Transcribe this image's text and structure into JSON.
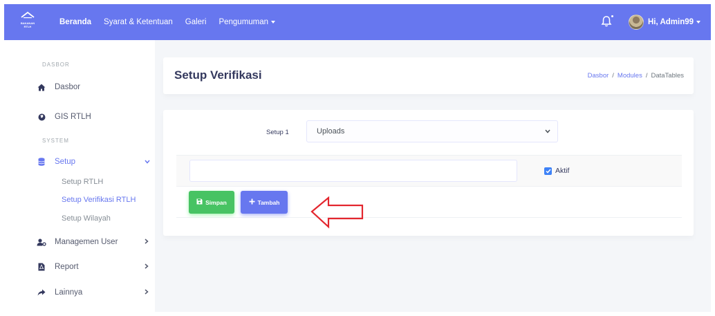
{
  "app": {
    "logo_text": [
      "BAKANAN",
      "RTLH"
    ]
  },
  "topnav": {
    "items": [
      {
        "label": "Beranda"
      },
      {
        "label": "Syarat & Ketentuan"
      },
      {
        "label": "Galeri"
      },
      {
        "label": "Pengumuman"
      }
    ],
    "notification_icon": "bell-icon",
    "user_greeting": "Hi, Admin99"
  },
  "sidebar": {
    "header_dasbor": "DASBOR",
    "header_system": "SYSTEM",
    "items": [
      {
        "label": "Dasbor",
        "icon": "home-icon"
      },
      {
        "label": "GIS RTLH",
        "icon": "globe-icon"
      },
      {
        "label": "Setup",
        "icon": "database-icon"
      },
      {
        "label": "Managemen User",
        "icon": "user-cog-icon"
      },
      {
        "label": "Report",
        "icon": "file-pdf-icon"
      },
      {
        "label": "Lainnya",
        "icon": "share-icon"
      }
    ],
    "submenu": [
      {
        "label": "Setup RTLH"
      },
      {
        "label": "Setup Verifikasi RTLH"
      },
      {
        "label": "Setup Wilayah"
      }
    ]
  },
  "page": {
    "title": "Setup Verifikasi",
    "breadcrumb": [
      "Dasbor",
      "Modules",
      "DataTables"
    ]
  },
  "form": {
    "setup_label": "Setup 1",
    "setup_selected": "Uploads",
    "text_value": "",
    "aktif_label": "Aktif",
    "aktif_checked": true,
    "save_label": "Simpan",
    "add_label": "Tambah"
  },
  "colors": {
    "primary": "#6777ef",
    "success": "#47c363",
    "annotation_arrow": "#e3262e"
  }
}
